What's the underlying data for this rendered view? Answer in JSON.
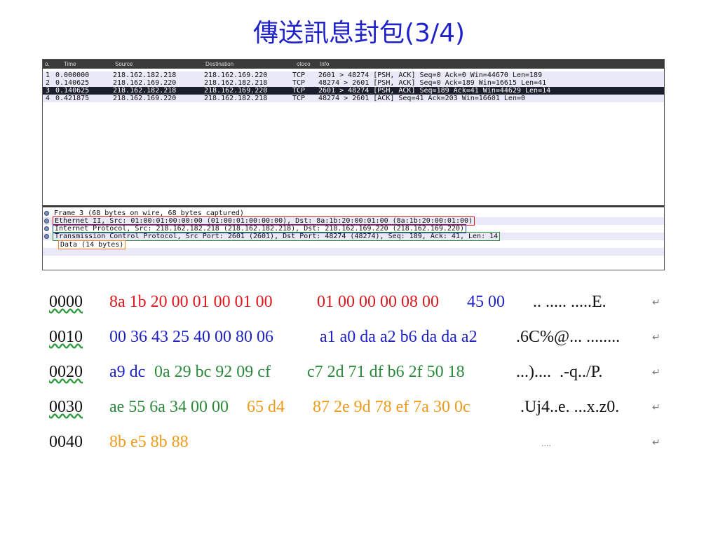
{
  "slide_title": "傳送訊息封包(3/4)",
  "packet_list": {
    "columns": [
      "o.",
      "Time",
      "Source",
      "Destination",
      "otoco",
      "Info"
    ],
    "rows": [
      {
        "no": "1",
        "time": "0.000000",
        "src": "218.162.182.218",
        "dst": "218.162.169.220",
        "proto": "TCP",
        "info": "2601 > 48274 [PSH, ACK] Seq=0 Ack=0 Win=44670 Len=189",
        "selected": false
      },
      {
        "no": "2",
        "time": "0.140625",
        "src": "218.162.169.220",
        "dst": "218.162.182.218",
        "proto": "TCP",
        "info": "48274 > 2601 [PSH, ACK] Seq=0 Ack=189 Win=16615 Len=41",
        "selected": false
      },
      {
        "no": "3",
        "time": "0.140625",
        "src": "218.162.182.218",
        "dst": "218.162.169.220",
        "proto": "TCP",
        "info": "2601 > 48274 [PSH, ACK] Seq=189 Ack=41 Win=44629 Len=14",
        "selected": true
      },
      {
        "no": "4",
        "time": "0.421875",
        "src": "218.162.169.220",
        "dst": "218.162.182.218",
        "proto": "TCP",
        "info": "48274 > 2601 [ACK] Seq=41 Ack=203 Win=16601 Len=0",
        "selected": false
      }
    ]
  },
  "packet_details": [
    {
      "text": "Frame 3 (68 bytes on wire, 68 bytes captured)",
      "box": "none",
      "expandable": true
    },
    {
      "text": "Ethernet II, Src: 01:00:01:00:00:00 (01:00:01:00:00:00), Dst: 8a:1b:20:00:01:00 (8a:1b:20:00:01:00)",
      "box": "red",
      "expandable": true
    },
    {
      "text": "Internet Protocol, Src: 218.162.182.218 (218.162.182.218), Dst: 218.162.169.220 (218.162.169.220)",
      "box": "blue",
      "expandable": true
    },
    {
      "text": "Transmission Control Protocol, Src Port: 2601 (2601), Dst Port: 48274 (48274), Seq: 189, Ack: 41, Len: 14",
      "box": "green",
      "expandable": true
    },
    {
      "text": "Data (14 bytes)",
      "box": "orange",
      "expandable": false
    }
  ],
  "hex_dump": [
    {
      "offset": "0000",
      "segments": [
        {
          "text": "8a 1b 20 00 01 00 01 00",
          "color": "red"
        },
        {
          "text": "01 00 00 00 08 00",
          "color": "red"
        },
        {
          "text": "45 00",
          "color": "blue"
        }
      ],
      "ascii": ".. ..... .....E."
    },
    {
      "offset": "0010",
      "segments": [
        {
          "text": "00 36 43 25 40 00 80 06",
          "color": "blue"
        },
        {
          "text": "a1 a0 da a2 b6 da da a2",
          "color": "blue"
        }
      ],
      "ascii": ".6C%@... ........"
    },
    {
      "offset": "0020",
      "segments": [
        {
          "text": "a9 dc",
          "color": "blue"
        },
        {
          "text": "0a 29 bc 92 09 cf",
          "color": "green"
        },
        {
          "text": "c7 2d 71 df b6 2f 50 18",
          "color": "green"
        }
      ],
      "ascii": "...)....  .-q../P."
    },
    {
      "offset": "0030",
      "segments": [
        {
          "text": "ae 55 6a 34 00 00",
          "color": "green"
        },
        {
          "text": "65 d4",
          "color": "orange"
        },
        {
          "text": "87 2e 9d 78 ef 7a 30 0c",
          "color": "orange"
        }
      ],
      "ascii": ".Uj4..e. ...x.z0."
    },
    {
      "offset": "0040",
      "segments": [
        {
          "text": "8b e5 8b 88",
          "color": "orange"
        }
      ],
      "ascii": "...."
    }
  ],
  "return_mark": "↵"
}
